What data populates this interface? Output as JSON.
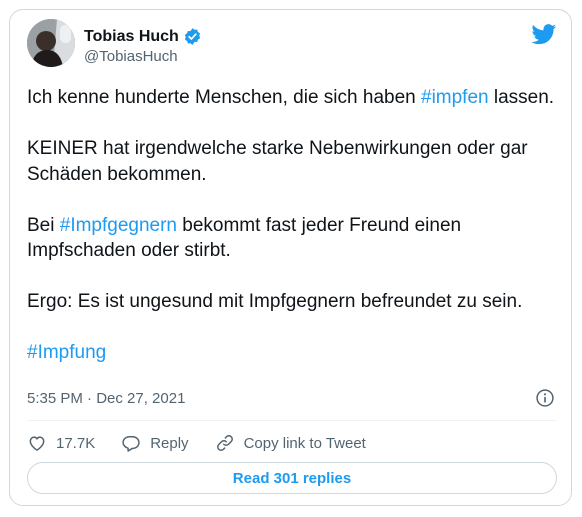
{
  "author": {
    "name": "Tobias Huch",
    "handle": "@TobiasHuch",
    "verified": true
  },
  "tweet": {
    "paragraphs": [
      [
        {
          "text": "Ich kenne hunderte Menschen, die sich haben ",
          "hashtag": false
        },
        {
          "text": "#impfen",
          "hashtag": true
        },
        {
          "text": " lassen.",
          "hashtag": false
        }
      ],
      [
        {
          "text": "KEINER hat irgendwelche starke Nebenwirkungen oder gar Schäden bekommen.",
          "hashtag": false
        }
      ],
      [
        {
          "text": "Bei ",
          "hashtag": false
        },
        {
          "text": "#Impfgegnern",
          "hashtag": true
        },
        {
          "text": " bekommt fast jeder Freund einen Impfschaden oder stirbt.",
          "hashtag": false
        }
      ],
      [
        {
          "text": "Ergo: Es ist ungesund mit Impfgegnern befreundet zu sein.",
          "hashtag": false
        }
      ],
      [
        {
          "text": "#Impfung",
          "hashtag": true
        }
      ]
    ],
    "timestamp": "5:35 PM · Dec 27, 2021"
  },
  "actions": {
    "like_count": "17.7K",
    "reply_label": "Reply",
    "copy_link_label": "Copy link to Tweet"
  },
  "read_replies_label": "Read 301 replies",
  "colors": {
    "accent": "#1d9bf0",
    "text": "#0f1419",
    "secondary": "#536471",
    "border": "#cfd9de"
  },
  "icons": [
    "verified-badge-icon",
    "twitter-bird-icon",
    "info-icon",
    "heart-icon",
    "reply-bubble-icon",
    "link-icon"
  ]
}
